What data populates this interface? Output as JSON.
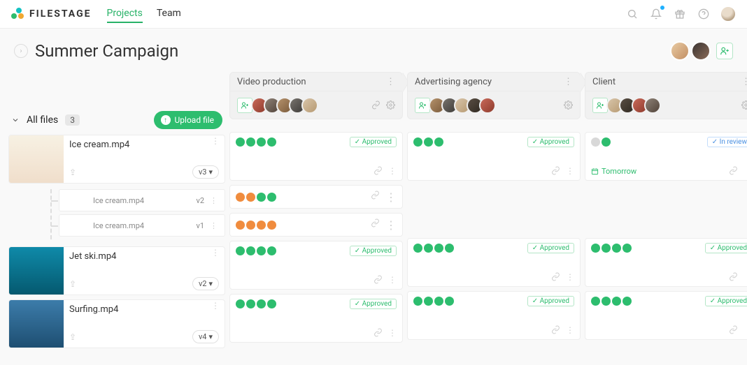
{
  "brand": "FILESTAGE",
  "nav": {
    "projects": "Projects",
    "team": "Team"
  },
  "project": {
    "title": "Summer Campaign"
  },
  "filesbar": {
    "label": "All files",
    "count": "3",
    "upload": "Upload file"
  },
  "files": [
    {
      "name": "Ice cream.mp4",
      "version": "v3",
      "subs": [
        {
          "name": "Ice cream.mp4",
          "version": "v2"
        },
        {
          "name": "Ice cream.mp4",
          "version": "v1"
        }
      ]
    },
    {
      "name": "Jet ski.mp4",
      "version": "v2"
    },
    {
      "name": "Surfing.mp4",
      "version": "v4"
    }
  ],
  "stages": [
    {
      "title": "Video production"
    },
    {
      "title": "Advertising agency"
    },
    {
      "title": "Client"
    }
  ],
  "statuses": {
    "approved": "Approved",
    "in_review": "In review"
  },
  "due": {
    "tomorrow": "Tomorrow"
  },
  "dot_colors": {
    "green": "#2dbd6e",
    "orange": "#f08c3e",
    "grey": "#d8d8d8"
  },
  "matrix": [
    [
      {
        "dots": [
          "g",
          "g",
          "g",
          "g"
        ],
        "status": "approved"
      },
      {
        "dots": [
          "g",
          "g",
          "g"
        ],
        "status": "approved"
      },
      {
        "dots": [
          "gr",
          "g"
        ],
        "status": "in_review",
        "due": "tomorrow"
      }
    ],
    [
      {
        "dots": [
          "o",
          "o",
          "g",
          "g"
        ]
      },
      null,
      null
    ],
    [
      {
        "dots": [
          "o",
          "o",
          "o",
          "o"
        ]
      },
      null,
      null
    ],
    [
      {
        "dots": [
          "g",
          "g",
          "g",
          "g"
        ],
        "status": "approved"
      },
      {
        "dots": [
          "g",
          "g",
          "g",
          "g"
        ],
        "status": "approved"
      },
      {
        "dots": [
          "g",
          "g",
          "g",
          "g"
        ],
        "status": "approved"
      }
    ],
    [
      {
        "dots": [
          "g",
          "g",
          "g",
          "g"
        ],
        "status": "approved"
      },
      {
        "dots": [
          "g",
          "g",
          "g",
          "g"
        ],
        "status": "approved"
      },
      {
        "dots": [
          "g",
          "g",
          "g",
          "g"
        ],
        "status": "approved"
      }
    ]
  ]
}
